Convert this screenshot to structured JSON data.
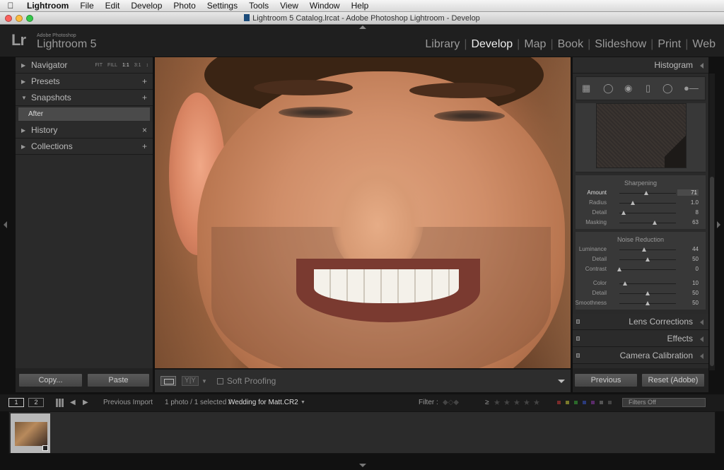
{
  "menubar": {
    "items": [
      "Lightroom",
      "File",
      "Edit",
      "Develop",
      "Photo",
      "Settings",
      "Tools",
      "View",
      "Window",
      "Help"
    ]
  },
  "window": {
    "title": "Lightroom 5 Catalog.lrcat - Adobe Photoshop Lightroom - Develop"
  },
  "app": {
    "logo": "Lr",
    "vendor": "Adobe Photoshop",
    "name": "Lightroom 5"
  },
  "modules": {
    "items": [
      "Library",
      "Develop",
      "Map",
      "Book",
      "Slideshow",
      "Print",
      "Web"
    ],
    "active": "Develop"
  },
  "left_panel": {
    "navigator": {
      "label": "Navigator",
      "zooms": [
        "FIT",
        "FILL",
        "1:1",
        "3:1"
      ]
    },
    "presets": {
      "label": "Presets",
      "action": "+"
    },
    "snapshots": {
      "label": "Snapshots",
      "action": "+",
      "items": [
        "After"
      ]
    },
    "history": {
      "label": "History",
      "action": "×"
    },
    "collections": {
      "label": "Collections",
      "action": "+"
    },
    "copy_label": "Copy...",
    "paste_label": "Paste"
  },
  "photo_toolbar": {
    "yy": "Y|Y",
    "soft_proofing": "Soft Proofing"
  },
  "right_panel": {
    "histogram_label": "Histogram",
    "sharpening": {
      "title": "Sharpening",
      "sliders": [
        {
          "label": "Amount",
          "value": "71",
          "fraction": 0.47
        },
        {
          "label": "Radius",
          "value": "1.0",
          "fraction": 0.24
        },
        {
          "label": "Detail",
          "value": "8",
          "fraction": 0.08
        },
        {
          "label": "Masking",
          "value": "63",
          "fraction": 0.63
        }
      ]
    },
    "noise_reduction": {
      "title": "Noise Reduction",
      "sliders": [
        {
          "label": "Luminance",
          "value": "44",
          "fraction": 0.44
        },
        {
          "label": "Detail",
          "value": "50",
          "fraction": 0.5
        },
        {
          "label": "Contrast",
          "value": "0",
          "fraction": 0.0
        }
      ],
      "color_sliders": [
        {
          "label": "Color",
          "value": "10",
          "fraction": 0.1
        },
        {
          "label": "Detail",
          "value": "50",
          "fraction": 0.5
        },
        {
          "label": "Smoothness",
          "value": "50",
          "fraction": 0.5
        }
      ]
    },
    "sections": [
      "Lens Corrections",
      "Effects",
      "Camera Calibration"
    ],
    "previous_label": "Previous",
    "reset_label": "Reset (Adobe)"
  },
  "filmstrip_bar": {
    "monitor1": "1",
    "monitor2": "2",
    "source": "Previous Import",
    "count": "1 photo / 1 selected /",
    "filename": "Wedding for Matt.CR2",
    "filter_label": "Filter :",
    "filters_off": "Filters Off"
  },
  "colors": {
    "accent": "#eeeeee",
    "panel": "#2a2a2a",
    "background": "#111111"
  }
}
